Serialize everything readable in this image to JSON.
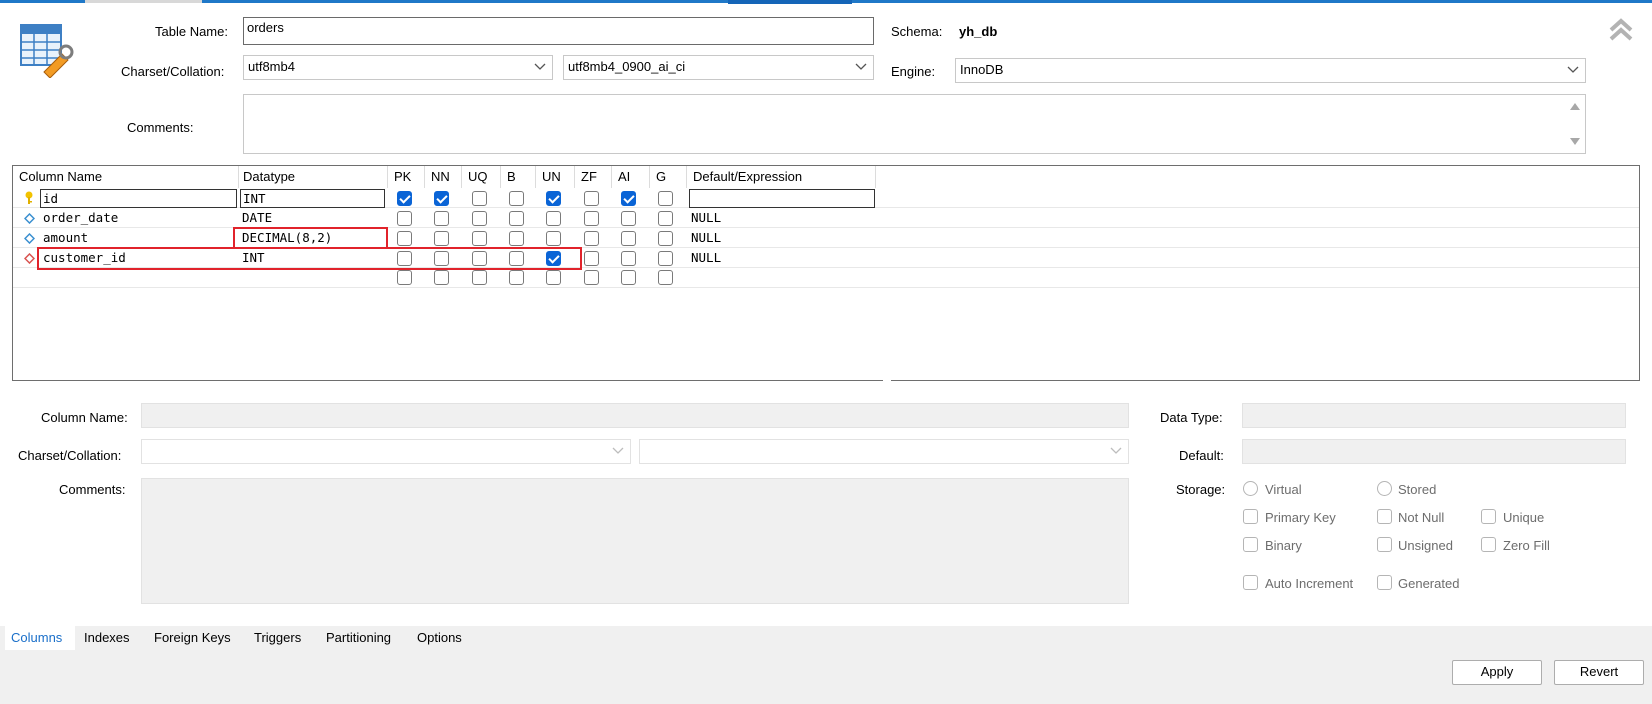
{
  "header": {
    "table_name_label": "Table Name:",
    "table_name_value": "orders",
    "schema_label": "Schema:",
    "schema_value": "yh_db",
    "charset_label": "Charset/Collation:",
    "charset_value": "utf8mb4",
    "collation_value": "utf8mb4_0900_ai_ci",
    "engine_label": "Engine:",
    "engine_value": "InnoDB",
    "comments_label": "Comments:"
  },
  "grid": {
    "headers": {
      "column_name": "Column Name",
      "datatype": "Datatype",
      "pk": "PK",
      "nn": "NN",
      "uq": "UQ",
      "b": "B",
      "un": "UN",
      "zf": "ZF",
      "ai": "AI",
      "g": "G",
      "default": "Default/Expression"
    },
    "rows": [
      {
        "name": "id",
        "datatype": "INT",
        "default": "",
        "icon": "primary-key-icon"
      },
      {
        "name": "order_date",
        "datatype": "DATE",
        "default": "NULL",
        "icon": "column-diamond-icon"
      },
      {
        "name": "amount",
        "datatype": "DECIMAL(8,2)",
        "default": "NULL",
        "icon": "column-diamond-icon"
      },
      {
        "name": "customer_id",
        "datatype": "INT",
        "default": "NULL",
        "icon": "foreign-key-diamond-icon"
      }
    ]
  },
  "detail": {
    "column_name_label": "Column Name:",
    "charset_label": "Charset/Collation:",
    "comments_label": "Comments:",
    "data_type_label": "Data Type:",
    "default_label": "Default:",
    "storage_label": "Storage:",
    "virtual": "Virtual",
    "stored": "Stored",
    "primary_key": "Primary Key",
    "not_null": "Not Null",
    "unique": "Unique",
    "binary": "Binary",
    "unsigned": "Unsigned",
    "zero_fill": "Zero Fill",
    "auto_increment": "Auto Increment",
    "generated": "Generated"
  },
  "tabs": [
    "Columns",
    "Indexes",
    "Foreign Keys",
    "Triggers",
    "Partitioning",
    "Options"
  ],
  "buttons": {
    "apply": "Apply",
    "revert": "Revert"
  },
  "colors": {
    "accent": "#0a64d6",
    "highlight": "#e1232b"
  }
}
